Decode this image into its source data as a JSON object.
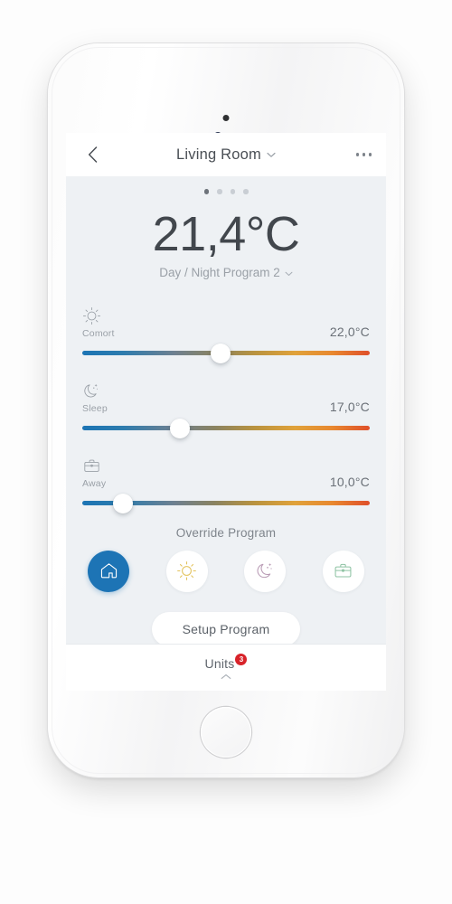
{
  "device": {
    "name": "iphone-white",
    "earpiece": "earpiece-speaker",
    "camera": "front-camera",
    "home_button": "home-button"
  },
  "navbar": {
    "back_icon": "chevron-left-icon",
    "title": "Living Room",
    "title_caret_icon": "chevron-down-icon",
    "more_icon": "ellipsis-icon"
  },
  "pager": {
    "count": 4,
    "active_index": 0
  },
  "temperature": {
    "value": "21,4°C",
    "program": "Day / Night Program 2",
    "program_caret_icon": "chevron-down-icon"
  },
  "sliders": [
    {
      "icon": "sun-icon",
      "label": "Comort",
      "value": "22,0°C",
      "position_percent": 48
    },
    {
      "icon": "moon-stars-icon",
      "label": "Sleep",
      "value": "17,0°C",
      "position_percent": 34
    },
    {
      "icon": "briefcase-icon",
      "label": "Away",
      "value": "10,0°C",
      "position_percent": 14
    }
  ],
  "override": {
    "title": "Override Program",
    "modes": [
      {
        "icon": "home-icon",
        "name": "home",
        "active": true,
        "color": "#ffffff"
      },
      {
        "icon": "sun-icon",
        "name": "comfort",
        "active": false,
        "color": "#e3c35c"
      },
      {
        "icon": "moon-stars-icon",
        "name": "sleep",
        "active": false,
        "color": "#b89ab4"
      },
      {
        "icon": "briefcase-icon",
        "name": "away",
        "active": false,
        "color": "#8fc3a4"
      }
    ]
  },
  "setup": {
    "label": "Setup Program"
  },
  "units": {
    "label": "Units",
    "badge": "3",
    "caret_icon": "chevron-up-icon"
  },
  "colors": {
    "accent": "#1d74b5",
    "badge": "#d8232a",
    "screen_bg": "#eef1f4",
    "track_cold": "#1b74b4",
    "track_hot": "#df4f2a"
  }
}
